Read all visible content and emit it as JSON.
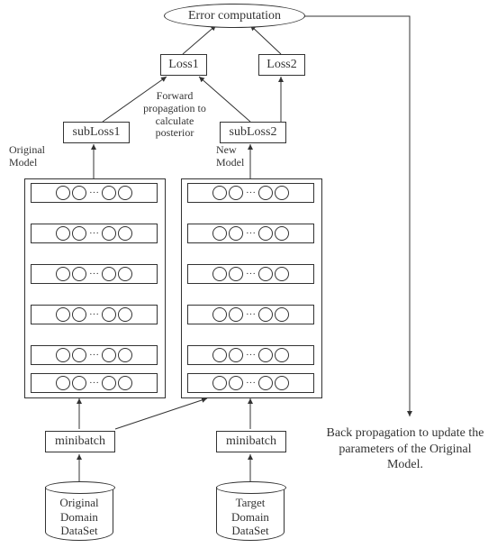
{
  "top": {
    "error_comp": "Error computation"
  },
  "losses": {
    "loss1": "Loss1",
    "loss2": "Loss2"
  },
  "sublosses": {
    "sub1": "subLoss1",
    "sub2": "subLoss2"
  },
  "model_labels": {
    "original": "Original\nModel",
    "new": "New\nModel"
  },
  "notes": {
    "fwd": "Forward\npropagation to\ncalculate\nposterior",
    "backprop": "Back propagation to update\nthe parameters of the\nOriginal Model."
  },
  "minibatch": {
    "left": "minibatch",
    "right": "minibatch"
  },
  "datasets": {
    "original": "Original\nDomain\nDataSet",
    "target": "Target\nDomain\nDataSet"
  }
}
